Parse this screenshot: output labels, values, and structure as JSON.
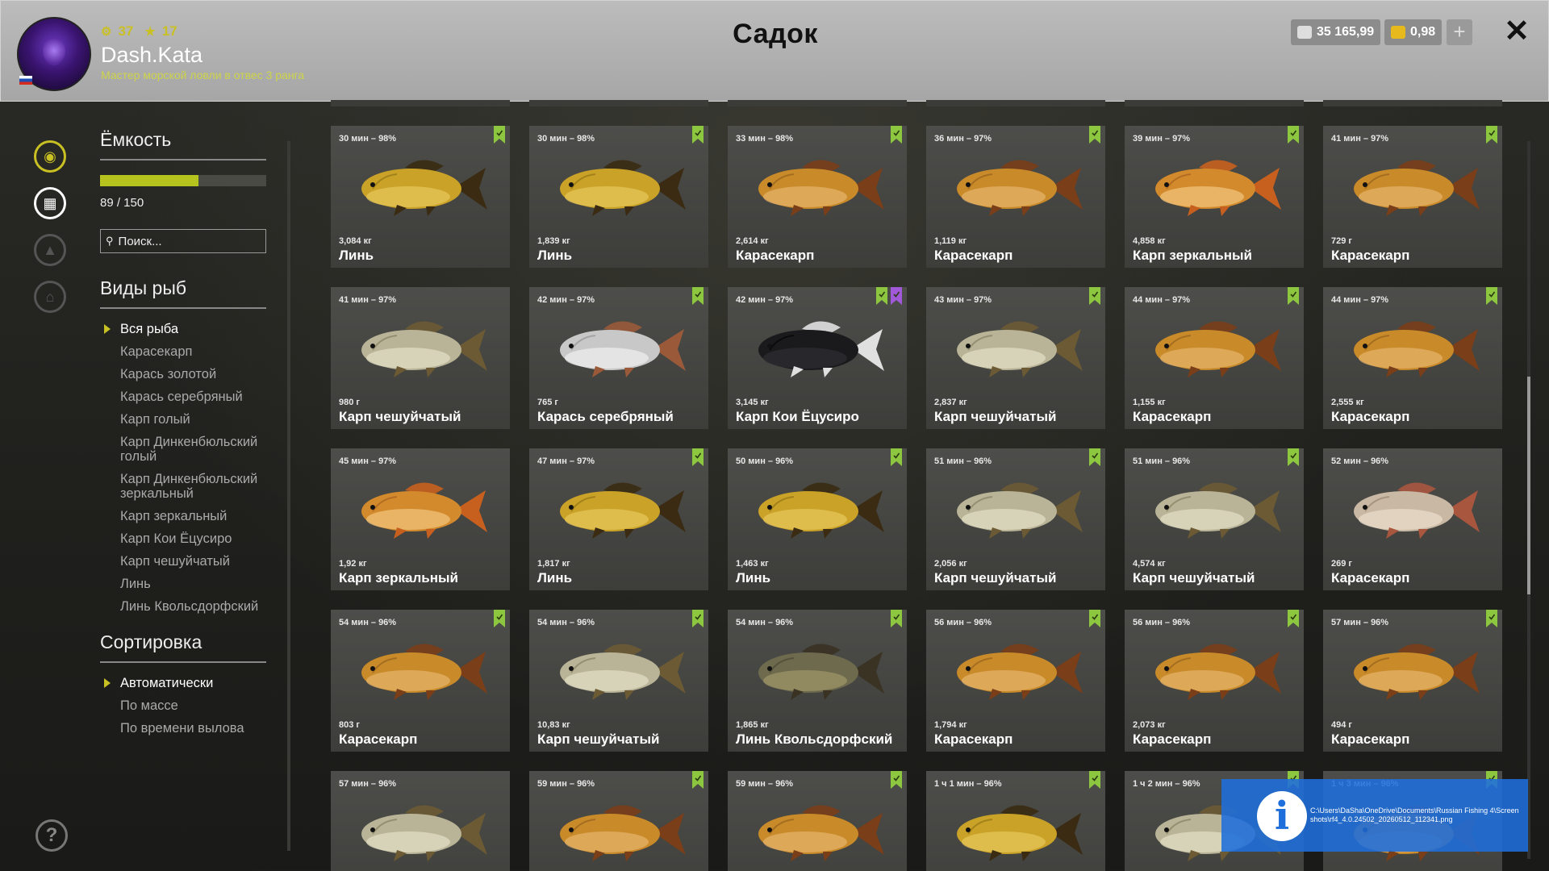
{
  "header": {
    "title": "Садок",
    "player": {
      "level": "37",
      "stars": "17",
      "name": "Dash.Kata",
      "rank": "Мастер морской ловли в отвес 3 ранга"
    },
    "currency": {
      "silver": "35 165,99",
      "gold": "0,98"
    }
  },
  "sidebar_icons": [
    "fish-icon",
    "keepnet-icon",
    "rank-icon",
    "home-icon",
    "help-icon"
  ],
  "panel": {
    "capacity_title": "Ёмкость",
    "capacity_text": "89 / 150",
    "capacity_fraction": 0.5933,
    "search_placeholder": "Поиск...",
    "species_title": "Виды рыб",
    "species": [
      "Вся рыба",
      "Карасекарп",
      "Карась золотой",
      "Карась серебряный",
      "Карп голый",
      "Карп Динкенбюльский голый",
      "Карп Динкенбюльский зеркальный",
      "Карп зеркальный",
      "Карп Кои Ёцусиро",
      "Карп чешуйчатый",
      "Линь",
      "Линь Квольсдорфский"
    ],
    "sort_title": "Сортировка",
    "sort_options": [
      "Автоматически",
      "По массе",
      "По времени вылова"
    ]
  },
  "fish_cards": [
    {
      "time": "30 мин – 98%",
      "weight": "3,084 кг",
      "name": "Линь",
      "fish": "tench",
      "marks": [
        "green"
      ]
    },
    {
      "time": "30 мин – 98%",
      "weight": "1,839 кг",
      "name": "Линь",
      "fish": "tench",
      "marks": [
        "green"
      ]
    },
    {
      "time": "33 мин – 98%",
      "weight": "2,614 кг",
      "name": "Карасекарп",
      "fish": "hybrid",
      "marks": [
        "green"
      ]
    },
    {
      "time": "36 мин – 97%",
      "weight": "1,119 кг",
      "name": "Карасекарп",
      "fish": "hybrid",
      "marks": [
        "green"
      ]
    },
    {
      "time": "39 мин – 97%",
      "weight": "4,858 кг",
      "name": "Карп зеркальный",
      "fish": "mirror",
      "marks": [
        "green"
      ]
    },
    {
      "time": "41 мин – 97%",
      "weight": "729 г",
      "name": "Карасекарп",
      "fish": "hybrid",
      "marks": [
        "green"
      ]
    },
    {
      "time": "41 мин – 97%",
      "weight": "980 г",
      "name": "Карп чешуйчатый",
      "fish": "common",
      "marks": []
    },
    {
      "time": "42 мин – 97%",
      "weight": "765 г",
      "name": "Карась серебряный",
      "fish": "silver",
      "marks": [
        "green"
      ]
    },
    {
      "time": "42 мин – 97%",
      "weight": "3,145 кг",
      "name": "Карп Кои Ёцусиро",
      "fish": "koi",
      "marks": [
        "green",
        "purple"
      ]
    },
    {
      "time": "43 мин – 97%",
      "weight": "2,837 кг",
      "name": "Карп чешуйчатый",
      "fish": "common",
      "marks": [
        "green"
      ]
    },
    {
      "time": "44 мин – 97%",
      "weight": "1,155 кг",
      "name": "Карасекарп",
      "fish": "hybrid",
      "marks": [
        "green"
      ]
    },
    {
      "time": "44 мин – 97%",
      "weight": "2,555 кг",
      "name": "Карасекарп",
      "fish": "hybrid",
      "marks": [
        "green"
      ]
    },
    {
      "time": "45 мин – 97%",
      "weight": "1,92 кг",
      "name": "Карп зеркальный",
      "fish": "mirror",
      "marks": []
    },
    {
      "time": "47 мин – 97%",
      "weight": "1,817 кг",
      "name": "Линь",
      "fish": "tench",
      "marks": [
        "green"
      ]
    },
    {
      "time": "50 мин – 96%",
      "weight": "1,463 кг",
      "name": "Линь",
      "fish": "tench",
      "marks": [
        "green"
      ]
    },
    {
      "time": "51 мин – 96%",
      "weight": "2,056 кг",
      "name": "Карп чешуйчатый",
      "fish": "common",
      "marks": [
        "green"
      ]
    },
    {
      "time": "51 мин – 96%",
      "weight": "4,574 кг",
      "name": "Карп чешуйчатый",
      "fish": "common",
      "marks": [
        "green"
      ]
    },
    {
      "time": "52 мин – 96%",
      "weight": "269 г",
      "name": "Карасекарп",
      "fish": "pale",
      "marks": []
    },
    {
      "time": "54 мин – 96%",
      "weight": "803 г",
      "name": "Карасекарп",
      "fish": "hybrid",
      "marks": [
        "green"
      ]
    },
    {
      "time": "54 мин – 96%",
      "weight": "10,83 кг",
      "name": "Карп чешуйчатый",
      "fish": "common",
      "marks": [
        "green"
      ]
    },
    {
      "time": "54 мин – 96%",
      "weight": "1,865 кг",
      "name": "Линь Квольсдорфский",
      "fish": "darktench",
      "marks": [
        "green"
      ]
    },
    {
      "time": "56 мин – 96%",
      "weight": "1,794 кг",
      "name": "Карасекарп",
      "fish": "hybrid",
      "marks": [
        "green"
      ]
    },
    {
      "time": "56 мин – 96%",
      "weight": "2,073 кг",
      "name": "Карасекарп",
      "fish": "hybrid",
      "marks": [
        "green"
      ]
    },
    {
      "time": "57 мин – 96%",
      "weight": "494 г",
      "name": "Карасекарп",
      "fish": "hybrid",
      "marks": [
        "green"
      ]
    },
    {
      "time": "57 мин – 96%",
      "weight": "",
      "name": "",
      "fish": "common",
      "marks": []
    },
    {
      "time": "59 мин – 96%",
      "weight": "",
      "name": "",
      "fish": "hybrid",
      "marks": [
        "green"
      ]
    },
    {
      "time": "59 мин – 96%",
      "weight": "",
      "name": "",
      "fish": "hybrid",
      "marks": [
        "green"
      ]
    },
    {
      "time": "1 ч 1 мин – 96%",
      "weight": "",
      "name": "",
      "fish": "tench",
      "marks": [
        "green"
      ]
    },
    {
      "time": "1 ч 2 мин – 96%",
      "weight": "",
      "name": "",
      "fish": "common",
      "marks": [
        "green"
      ]
    },
    {
      "time": "1 ч 3 мин – 96%",
      "weight": "",
      "name": "",
      "fish": "hybrid",
      "marks": [
        "green"
      ]
    }
  ],
  "notification": {
    "icon": "info-icon",
    "path": "C:\\Users\\DaSha\\OneDrive\\Documents\\Russian Fishing 4\\Screenshots\\rf4_4.0.24502_20260512_112341.png"
  },
  "colors": {
    "accent": "#c9c023",
    "bookmark_green": "#8dc63f",
    "bookmark_purple": "#a259d9",
    "notification": "#1e6edc"
  }
}
